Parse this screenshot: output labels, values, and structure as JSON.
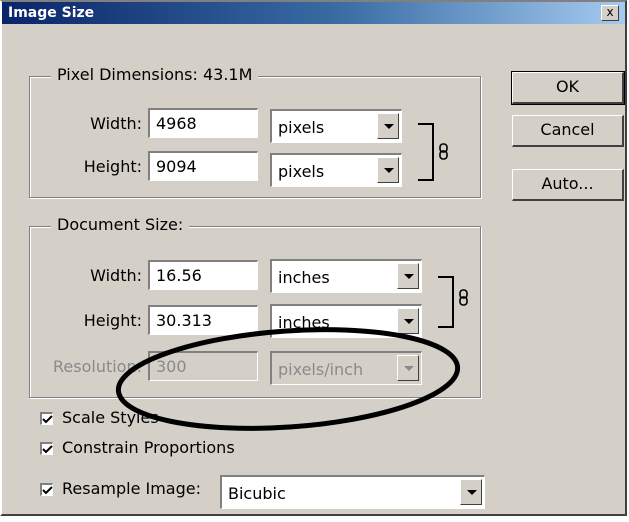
{
  "window": {
    "title": "Image Size",
    "close_label": "x"
  },
  "pixel_dimensions": {
    "legend": "Pixel Dimensions:  43.1M",
    "width": {
      "label": "Width:",
      "value": "4968",
      "unit": "pixels"
    },
    "height": {
      "label": "Height:",
      "value": "9094",
      "unit": "pixels"
    }
  },
  "document_size": {
    "legend": "Document Size:",
    "width": {
      "label": "Width:",
      "value": "16.56",
      "unit": "inches"
    },
    "height": {
      "label": "Height:",
      "value": "30.313",
      "unit": "inches"
    },
    "resolution": {
      "label": "Resolution:",
      "value": "300",
      "unit": "pixels/inch",
      "disabled": true
    }
  },
  "buttons": {
    "ok": "OK",
    "cancel": "Cancel",
    "auto": "Auto..."
  },
  "options": {
    "scale_styles": {
      "label": "Scale Styles",
      "checked": true
    },
    "constrain_proportions": {
      "label": "Constrain Proportions",
      "checked": true
    },
    "resample": {
      "label": "Resample Image:",
      "checked": true,
      "method": "Bicubic"
    }
  },
  "icons": [
    "close-icon",
    "link-chain-icon",
    "dropdown-arrow-icon",
    "checkmark-icon"
  ],
  "colors": {
    "titlebar": "#0a246a",
    "dialog": "#d4d0c8",
    "annotation": "#000000"
  }
}
